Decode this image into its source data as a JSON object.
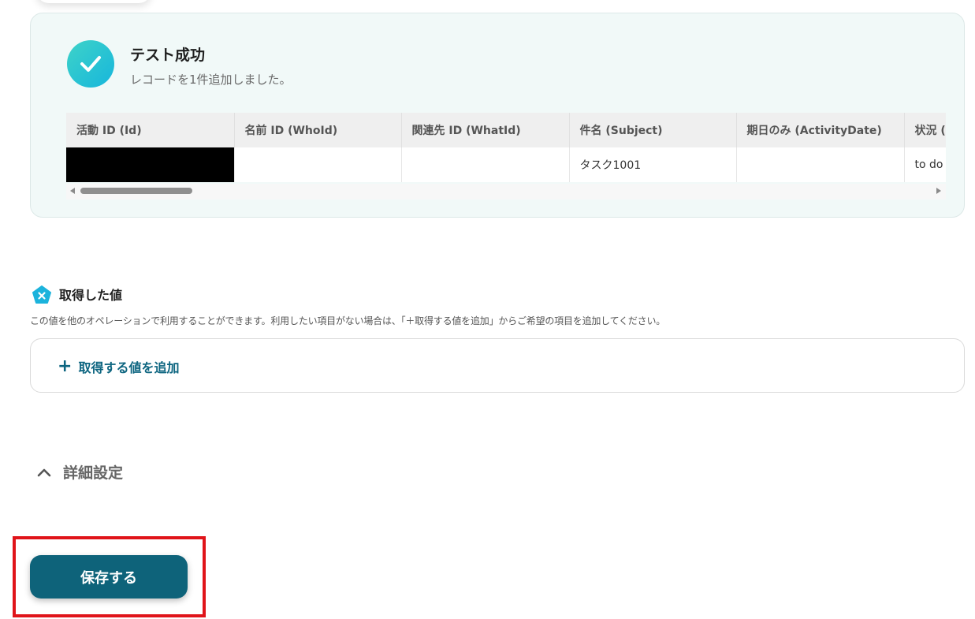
{
  "success": {
    "title": "テスト成功",
    "message": "レコードを1件追加しました。",
    "table": {
      "headers": [
        "活動 ID (Id)",
        "名前 ID (WhoId)",
        "関連先 ID (WhatId)",
        "件名 (Subject)",
        "期日のみ (ActivityDate)",
        "状況 ("
      ],
      "row": [
        "",
        "",
        "",
        "タスク1001",
        "",
        "to do"
      ]
    }
  },
  "acquired": {
    "title": "取得した値",
    "description": "この値を他のオペレーションで利用することができます。利用したい項目がない場合は、「＋取得する値を追加」からご希望の項目を追加してください。",
    "add_label": "取得する値を追加"
  },
  "details": {
    "label": "詳細設定"
  },
  "save": {
    "label": "保存する"
  },
  "colors": {
    "accent": "#0e637a",
    "highlight": "#e0141a",
    "success_gradient_start": "#3ed3c8",
    "success_gradient_end": "#17b6dc"
  }
}
